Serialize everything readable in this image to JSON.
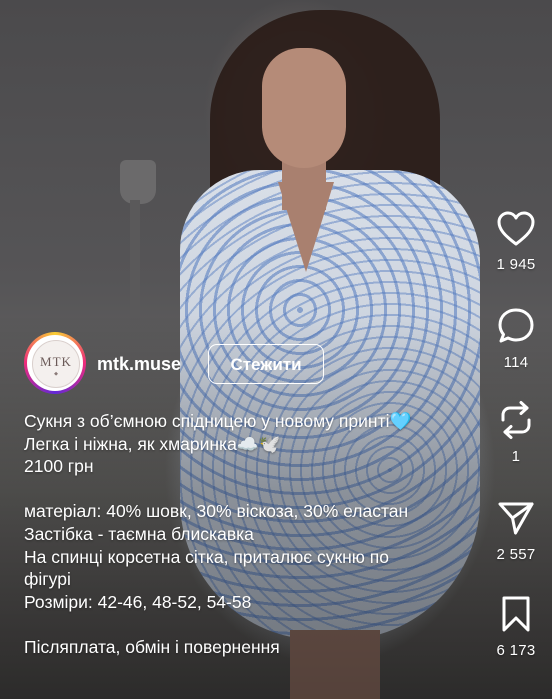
{
  "account": {
    "username": "mtk.muse",
    "follow_label": "Стежити",
    "avatar_logo_text": "MTK"
  },
  "caption": {
    "lines": [
      "Сукня з об’ємною спідницею у новому принті",
      "Легка і ніжна, як хмаринка",
      "2100 грн",
      "",
      "матеріал: 40% шовк, 30% віскоза, 30% еластан",
      "Застібка - таємна блискавка",
      "На спинці корсетна сітка, приталює сукню по",
      "фігурі",
      "Розміри: 42-46, 48-52, 54-58",
      "",
      "Післяплата, обмін і повернення"
    ],
    "emoji_heart": "🩵",
    "emoji_cloud_dove": "☁️🕊️"
  },
  "actions": {
    "like_count": "1 945",
    "comment_count": "114",
    "repost_count": "1",
    "share_count": "2 557",
    "save_count": "6 173"
  },
  "icons": {
    "like": "heart-icon",
    "comment": "comment-bubble-icon",
    "repost": "repost-icon",
    "share": "send-icon",
    "save": "bookmark-icon"
  },
  "colors": {
    "text": "#ffffff",
    "story_ring": [
      "#f9ce34",
      "#ee2a7b",
      "#6228d7"
    ]
  }
}
